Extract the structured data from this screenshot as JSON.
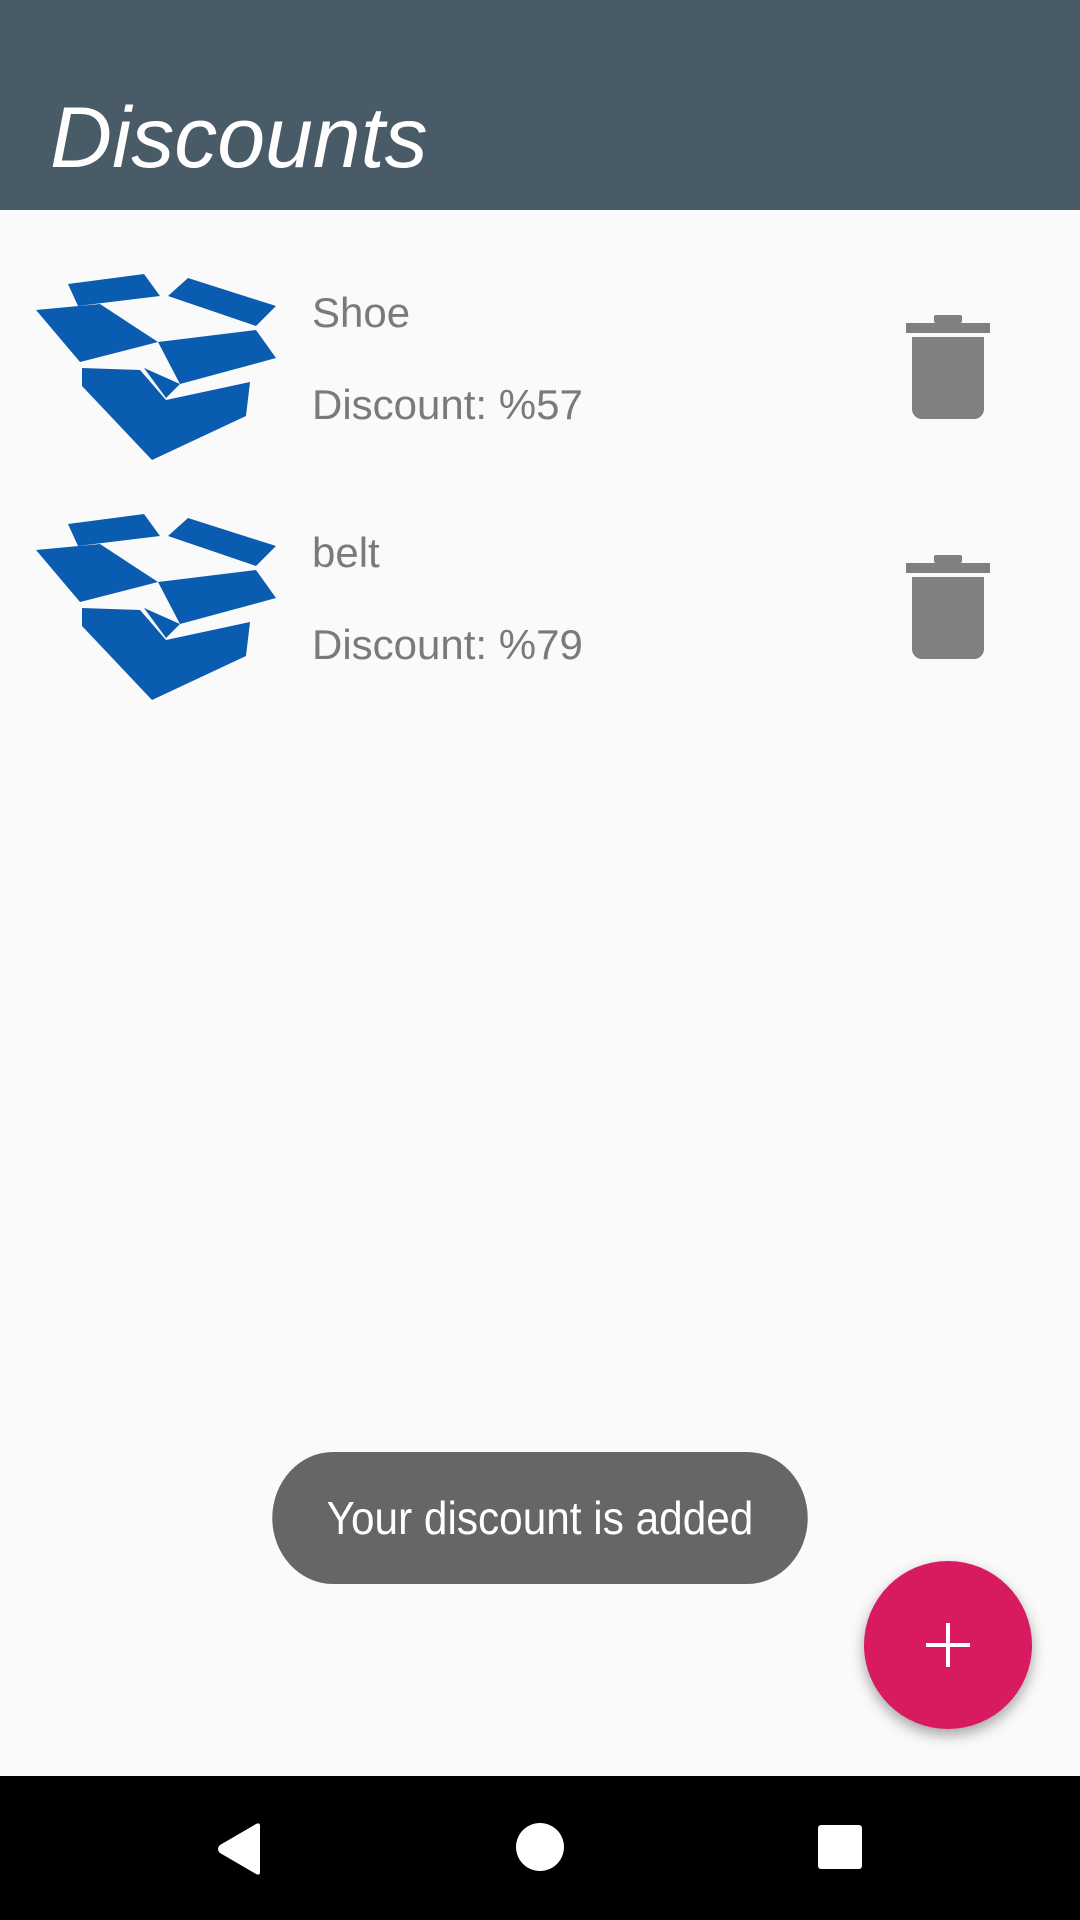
{
  "app_bar": {
    "title": "Discounts",
    "color": "#485b66"
  },
  "discounts": [
    {
      "name": "Shoe",
      "discount": "Discount: %57",
      "icon": "open-box-icon",
      "action_icon": "trash-icon"
    },
    {
      "name": "belt",
      "discount": "Discount: %79",
      "icon": "open-box-icon",
      "action_icon": "trash-icon"
    }
  ],
  "toast": {
    "message": "Your discount is added"
  },
  "fab": {
    "icon": "plus-icon",
    "color": "#d81b60"
  },
  "navigation": {
    "buttons": [
      "back-icon",
      "home-icon",
      "recents-icon"
    ]
  },
  "colors": {
    "icon_blue": "#0a5cb0",
    "trash_gray": "#808080",
    "text_gray": "#7a7a7a"
  }
}
